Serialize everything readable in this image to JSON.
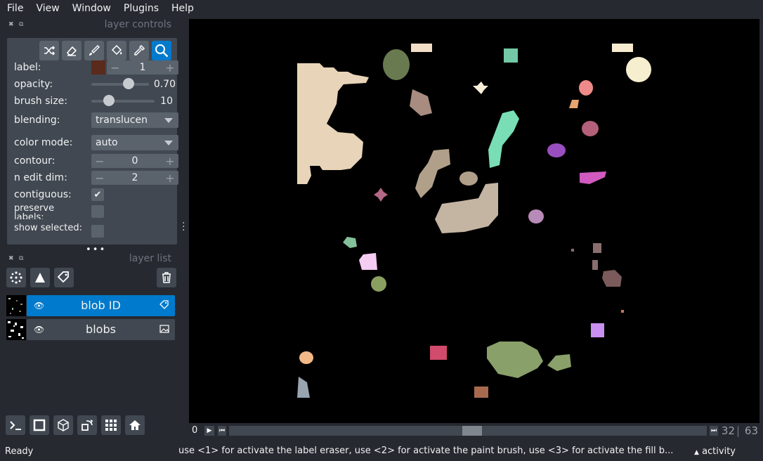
{
  "menu": [
    "File",
    "View",
    "Window",
    "Plugins",
    "Help"
  ],
  "layer_controls": {
    "title": "layer controls",
    "label_label": "label:",
    "label_value": "1",
    "label_color": "#5a2a1c",
    "opacity_label": "opacity:",
    "opacity_value": "0.70",
    "opacity_fraction": 0.7,
    "brush_size_label": "brush size:",
    "brush_size_value": "10",
    "blending_label": "blending:",
    "blending_value": "translucen",
    "color_mode_label": "color mode:",
    "color_mode_value": "auto",
    "contour_label": "contour:",
    "contour_value": "0",
    "n_edit_dim_label": "n edit dim:",
    "n_edit_dim_value": "2",
    "contiguous_label": "contiguous:",
    "contiguous_checked": true,
    "preserve_labels_label": "preserve labels:",
    "preserve_labels_checked": false,
    "show_selected_label": "show selected:",
    "show_selected_checked": false,
    "spin_minus": "−",
    "spin_plus": "+"
  },
  "layer_list": {
    "title": "layer list",
    "layers": [
      {
        "name": "blob ID",
        "selected": true,
        "type_icon": "label-icon"
      },
      {
        "name": "blobs",
        "selected": false,
        "type_icon": "image-icon"
      }
    ]
  },
  "dims": {
    "index": "0",
    "current": "32",
    "separator": "|",
    "total": "63"
  },
  "status": {
    "ready": "Ready",
    "message": "use <1> for activate the label eraser, use <2> for activate the paint brush, use <3> for activate the fill b...",
    "activity": "activity"
  }
}
